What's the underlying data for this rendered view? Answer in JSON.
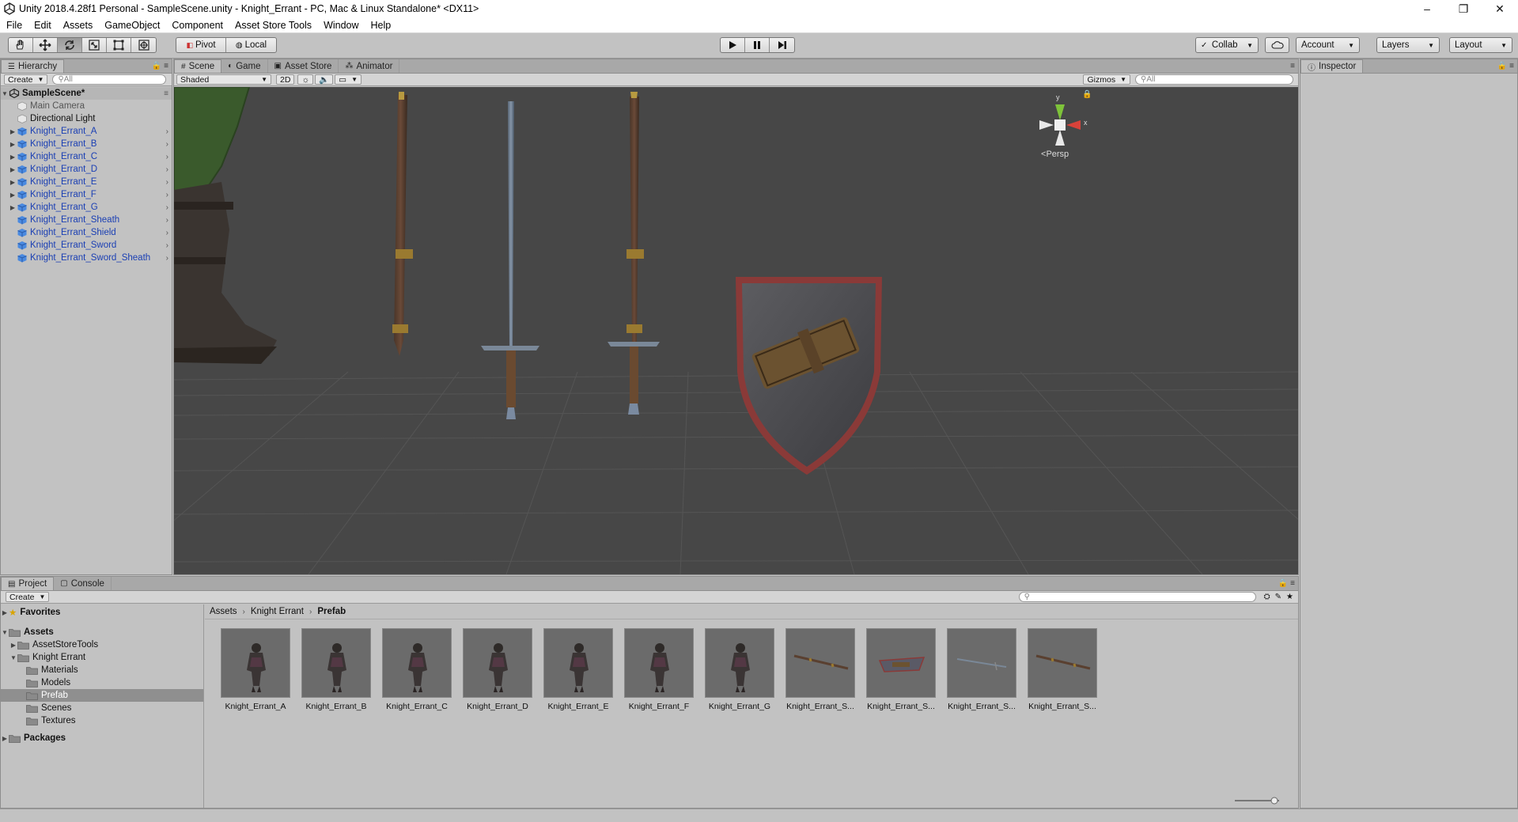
{
  "window": {
    "title": "Unity 2018.4.28f1 Personal - SampleScene.unity - Knight_Errant - PC, Mac & Linux Standalone* <DX11>",
    "controls": [
      "–",
      "❐",
      "✕"
    ]
  },
  "menu": [
    "File",
    "Edit",
    "Assets",
    "GameObject",
    "Component",
    "Asset Store Tools",
    "Window",
    "Help"
  ],
  "toolbar": {
    "pivot_label": "Pivot",
    "local_label": "Local",
    "collab_label": "Collab",
    "account_label": "Account",
    "layers_label": "Layers",
    "layout_label": "Layout"
  },
  "hierarchy": {
    "tab_label": "Hierarchy",
    "create_label": "Create",
    "search_placeholder": "All",
    "scene_name": "SampleScene*",
    "items": [
      {
        "label": "Main Camera",
        "type": "dim"
      },
      {
        "label": "Directional Light",
        "type": "plain"
      },
      {
        "label": "Knight_Errant_A",
        "type": "prefab"
      },
      {
        "label": "Knight_Errant_B",
        "type": "prefab"
      },
      {
        "label": "Knight_Errant_C",
        "type": "prefab"
      },
      {
        "label": "Knight_Errant_D",
        "type": "prefab"
      },
      {
        "label": "Knight_Errant_E",
        "type": "prefab"
      },
      {
        "label": "Knight_Errant_F",
        "type": "prefab"
      },
      {
        "label": "Knight_Errant_G",
        "type": "prefab"
      },
      {
        "label": "Knight_Errant_Sheath",
        "type": "prefab"
      },
      {
        "label": "Knight_Errant_Shield",
        "type": "prefab"
      },
      {
        "label": "Knight_Errant_Sword",
        "type": "prefab"
      },
      {
        "label": "Knight_Errant_Sword_Sheath",
        "type": "prefab"
      }
    ]
  },
  "scene_tabs": {
    "scene": "Scene",
    "game": "Game",
    "asset_store": "Asset Store",
    "animator": "Animator"
  },
  "scene_bar": {
    "shading": "Shaded",
    "mode_2d": "2D",
    "gizmos": "Gizmos",
    "search_placeholder": "All",
    "persp_label": "Persp",
    "axis_y": "y",
    "axis_x": "x"
  },
  "inspector": {
    "tab_label": "Inspector"
  },
  "project": {
    "tab_project": "Project",
    "tab_console": "Console",
    "create_label": "Create",
    "favorites": "Favorites",
    "tree": [
      {
        "label": "Assets",
        "level": 0,
        "bold": true
      },
      {
        "label": "AssetStoreTools",
        "level": 1
      },
      {
        "label": "Knight Errant",
        "level": 1
      },
      {
        "label": "Materials",
        "level": 2
      },
      {
        "label": "Models",
        "level": 2
      },
      {
        "label": "Prefab",
        "level": 2,
        "selected": true
      },
      {
        "label": "Scenes",
        "level": 2
      },
      {
        "label": "Textures",
        "level": 2
      },
      {
        "label": "Packages",
        "level": 0,
        "bold": true
      }
    ],
    "breadcrumb": [
      "Assets",
      "Knight Errant",
      "Prefab"
    ],
    "assets": [
      {
        "label": "Knight_Errant_A",
        "kind": "knight"
      },
      {
        "label": "Knight_Errant_B",
        "kind": "knight"
      },
      {
        "label": "Knight_Errant_C",
        "kind": "knight"
      },
      {
        "label": "Knight_Errant_D",
        "kind": "knight"
      },
      {
        "label": "Knight_Errant_E",
        "kind": "knight"
      },
      {
        "label": "Knight_Errant_F",
        "kind": "knight"
      },
      {
        "label": "Knight_Errant_G",
        "kind": "knight"
      },
      {
        "label": "Knight_Errant_S...",
        "kind": "sheath"
      },
      {
        "label": "Knight_Errant_S...",
        "kind": "shield"
      },
      {
        "label": "Knight_Errant_S...",
        "kind": "sword"
      },
      {
        "label": "Knight_Errant_S...",
        "kind": "sheath"
      }
    ]
  },
  "colors": {
    "prefab_blue": "#1a3fb4",
    "scene_bg": "#474747",
    "panel_bg": "#c2c2c2"
  }
}
